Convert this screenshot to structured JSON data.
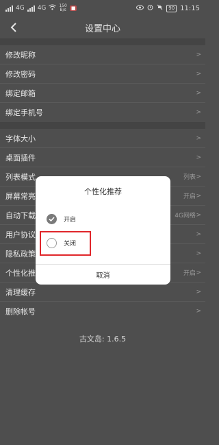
{
  "statusbar": {
    "carrier1": "4G",
    "carrier2": "4G",
    "netspeed_top": "150",
    "netspeed_bottom": "B/s",
    "battery": "90",
    "time": "11:15"
  },
  "header": {
    "title": "设置中心"
  },
  "groups": [
    {
      "items": [
        {
          "label": "修改昵称"
        },
        {
          "label": "修改密码"
        },
        {
          "label": "绑定邮箱"
        },
        {
          "label": "绑定手机号"
        }
      ]
    },
    {
      "items": [
        {
          "label": "字体大小"
        },
        {
          "label": "桌面插件"
        },
        {
          "label": "列表模式",
          "value": "列表"
        },
        {
          "label": "屏幕常亮",
          "value": "开启"
        },
        {
          "label": "自动下载",
          "value": "4G网络"
        },
        {
          "label": "用户协议"
        },
        {
          "label": "隐私政策"
        },
        {
          "label": "个性化推荐",
          "value": "开启"
        },
        {
          "label": "清理缓存"
        },
        {
          "label": "删除帐号"
        }
      ]
    }
  ],
  "version": "古文岛: 1.6.5",
  "dialog": {
    "title": "个性化推荐",
    "option_on": "开启",
    "option_off": "关闭",
    "cancel": "取消"
  },
  "colors": {
    "highlight": "#e0262b"
  }
}
